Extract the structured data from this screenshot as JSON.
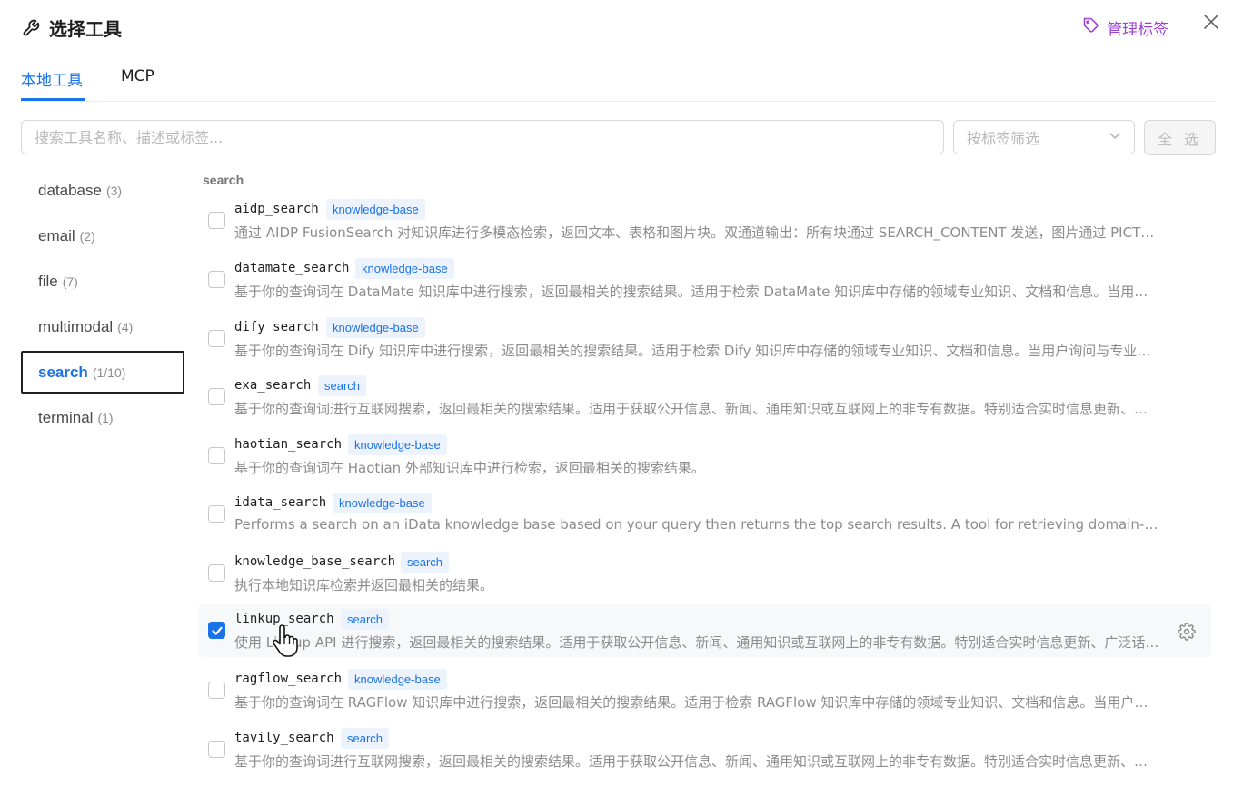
{
  "header": {
    "title": "选择工具",
    "title_icon": "wrench-icon",
    "manage_tags_label": "管理标签",
    "manage_tags_icon": "tag-icon",
    "close_icon": "close-icon"
  },
  "tabs": [
    {
      "label": "本地工具",
      "active": true
    },
    {
      "label": "MCP",
      "active": false
    }
  ],
  "toolbar": {
    "search_placeholder": "搜索工具名称、描述或标签...",
    "search_value": "",
    "tag_filter_placeholder": "按标签筛选",
    "select_all_label": "全 选"
  },
  "colors": {
    "accent": "#1a73e8",
    "manage_tags": "#9b3fd6",
    "tag_bg": "#edf3fd"
  },
  "sidebar": {
    "items": [
      {
        "name": "database",
        "count": "(3)",
        "active": false
      },
      {
        "name": "email",
        "count": "(2)",
        "active": false
      },
      {
        "name": "file",
        "count": "(7)",
        "active": false
      },
      {
        "name": "multimodal",
        "count": "(4)",
        "active": false
      },
      {
        "name": "search",
        "count": "(1/10)",
        "active": true
      },
      {
        "name": "terminal",
        "count": "(1)",
        "active": false
      }
    ]
  },
  "group_label": "search",
  "tools": [
    {
      "name": "aidp_search",
      "tag": "knowledge-base",
      "checked": false,
      "desc": "通过 AIDP FusionSearch 对知识库进行多模态检索，返回文本、表格和图片块。双通道输出：所有块通过 SEARCH_CONTENT 发送，图片通过 PICTURE_WEB 发送"
    },
    {
      "name": "datamate_search",
      "tag": "knowledge-base",
      "checked": false,
      "desc": "基于你的查询词在 DataMate 知识库中进行搜索，返回最相关的搜索结果。适用于检索 DataMate 知识库中存储的领域专业知识、文档和信息。当用户询问与专业"
    },
    {
      "name": "dify_search",
      "tag": "knowledge-base",
      "checked": false,
      "desc": "基于你的查询词在 Dify 知识库中进行搜索，返回最相关的搜索结果。适用于检索 Dify 知识库中存储的领域专业知识、文档和信息。当用户询问与专业知识相关"
    },
    {
      "name": "exa_search",
      "tag": "search",
      "checked": false,
      "desc": "基于你的查询词进行互联网搜索，返回最相关的搜索结果。适用于获取公开信息、新闻、通用知识或互联网上的非专有数据。特别适合实时信息更新、广泛话题"
    },
    {
      "name": "haotian_search",
      "tag": "knowledge-base",
      "checked": false,
      "desc": "基于你的查询词在 Haotian 外部知识库中进行检索，返回最相关的搜索结果。"
    },
    {
      "name": "idata_search",
      "tag": "knowledge-base",
      "checked": false,
      "desc": "Performs a search on an iData knowledge base based on your query then returns the top search results. A tool for retrieving domain-specific knowledge, documents"
    },
    {
      "name": "knowledge_base_search",
      "tag": "search",
      "checked": false,
      "desc": "执行本地知识库检索并返回最相关的结果。"
    },
    {
      "name": "linkup_search",
      "tag": "search",
      "checked": true,
      "desc": "使用 Linkup API 进行搜索，返回最相关的搜索结果。适用于获取公开信息、新闻、通用知识或互联网上的非专有数据。特别适合实时信息更新、广泛话题的查询"
    },
    {
      "name": "ragflow_search",
      "tag": "knowledge-base",
      "checked": false,
      "desc": "基于你的查询词在 RAGFlow 知识库中进行搜索，返回最相关的搜索结果。适用于检索 RAGFlow 知识库中存储的领域专业知识、文档和信息。当用户询问与专业"
    },
    {
      "name": "tavily_search",
      "tag": "search",
      "checked": false,
      "desc": "基于你的查询词进行互联网搜索，返回最相关的搜索结果。适用于获取公开信息、新闻、通用知识或互联网上的非专有数据。特别适合实时信息更新、广泛话题"
    }
  ]
}
